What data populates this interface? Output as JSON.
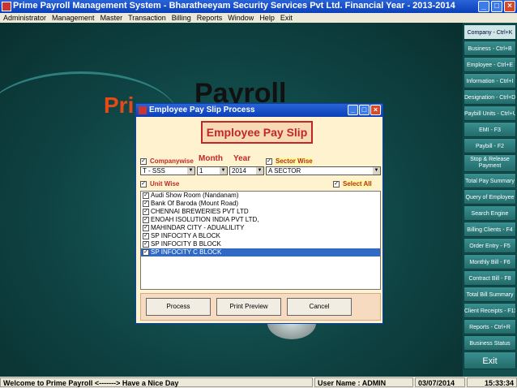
{
  "window": {
    "title": "Prime Payroll Management System - Bharatheeyam Security Services Pvt Ltd. Financial Year - 2013-2014"
  },
  "menu": [
    "Administrator",
    "Management",
    "Master",
    "Transaction",
    "Billing",
    "Reports",
    "Window",
    "Help",
    "Exit"
  ],
  "logo": {
    "pri": "Pri",
    "payroll": "Payroll"
  },
  "sidebar": [
    "Company - Ctrl+K",
    "Business - Ctrl+B",
    "Employee - Ctrl+E",
    "Information - Ctrl+I",
    "Designation - Ctrl+D",
    "Paybill Units - Ctrl+U",
    "EMI - F3",
    "Paybill - F2",
    "Stop & Release Payment",
    "Total Pay Summary",
    "Query of Employee",
    "Search Engine",
    "Billing Clients - F4",
    "Order Entry - F5",
    "Monthly Bill - F6",
    "Contract Bill - F8",
    "Total Bill Summary",
    "Client Receipts - F11",
    "Reports - Ctrl+R",
    "Business Status",
    "Exit"
  ],
  "dialog": {
    "title": "Employee Pay Slip Process",
    "banner": "Employee Pay Slip",
    "companywise_label": "Companywise",
    "month_label": "Month",
    "year_label": "Year",
    "sector_label": "Sector Wise",
    "company_value": "T - SSS",
    "month_value": "1",
    "year_value": "2014",
    "sector_value": "A SECTOR",
    "unitwise_label": "Unit Wise",
    "selectall_label": "Select All",
    "units": [
      "Audi Show Room (Nandanam)",
      "Bank Of Baroda (Mount Road)",
      "CHENNAI BREWERIES PVT LTD",
      "ENOAH ISOLUTION INDIA PVT LTD,",
      "MAHINDAR CITY - ADUALILITY",
      "SP INFOCITY A BLOCK",
      "SP INFOCITY B BLOCK",
      "SP INFOCITY C BLOCK"
    ],
    "process_button": "Process",
    "print_preview_button": "Print Preview",
    "cancel_button": "Cancel"
  },
  "status": {
    "welcome": "Welcome to Prime Payroll  <-------> Have a Nice Day",
    "user": "User Name : ADMIN",
    "date": "03/07/2014",
    "time": "15:33:34"
  }
}
